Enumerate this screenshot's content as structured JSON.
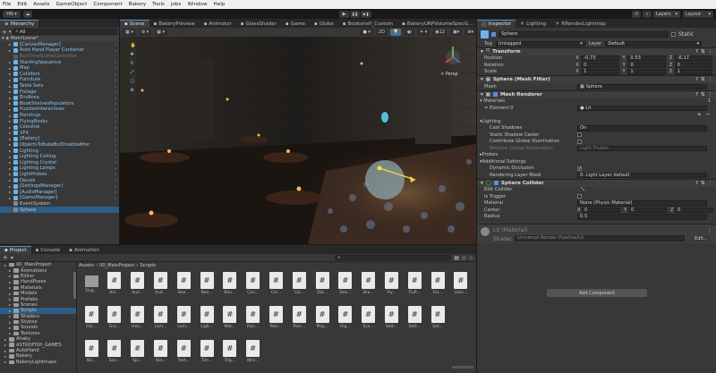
{
  "menu": [
    "File",
    "Edit",
    "Assets",
    "GameObject",
    "Component",
    "Bakery",
    "Tools",
    "Jobs",
    "Window",
    "Help"
  ],
  "toolbar": {
    "account": "HN",
    "cloud": "☁",
    "layers": "Layers",
    "layout": "Layout",
    "play": "▶",
    "pause": "❚❚",
    "step": "▶❚"
  },
  "hierarchy": {
    "tab": "Hierarchy",
    "search_placeholder": "All",
    "scene_name": "MainScene*",
    "items": [
      {
        "label": "[CanvasManager]",
        "blue": true
      },
      {
        "label": "Auto Hand Player Container",
        "blue": true
      },
      {
        "label": "RunTimeSceneController",
        "blue": false,
        "dim": true
      },
      {
        "label": "StartingSequence",
        "blue": true
      },
      {
        "label": "Map",
        "blue": true
      },
      {
        "label": "Colliders",
        "blue": true
      },
      {
        "label": "Furniture",
        "blue": true
      },
      {
        "label": "Table Sets",
        "blue": true
      },
      {
        "label": "Foliage",
        "blue": true
      },
      {
        "label": "EndArea",
        "blue": true
      },
      {
        "label": "BookShelvesPopulators",
        "blue": true
      },
      {
        "label": "PuzzlesInteractives",
        "blue": true
      },
      {
        "label": "Paintings",
        "blue": true
      },
      {
        "label": "FlyingBooks",
        "blue": true
      },
      {
        "label": "Celestial",
        "blue": true
      },
      {
        "label": "VFX",
        "blue": true
      },
      {
        "label": "[Bakery]",
        "blue": true
      },
      {
        "label": "ObjectsToBakeButDisableAfter",
        "blue": true
      },
      {
        "label": "Lighting",
        "blue": true
      },
      {
        "label": "Lighting Ceiling",
        "blue": true
      },
      {
        "label": "Lighting Crystal",
        "blue": true
      },
      {
        "label": "Lighting Lamps",
        "blue": true
      },
      {
        "label": "LightProbes",
        "blue": true
      },
      {
        "label": "Decals",
        "blue": true
      },
      {
        "label": "[SettingsManager]",
        "blue": true
      },
      {
        "label": "[AudioManager]",
        "blue": true
      },
      {
        "label": "[GameManager]",
        "blue": true
      },
      {
        "label": "EventSystem",
        "blue": false
      },
      {
        "label": "Sphere",
        "blue": false,
        "selected": true
      }
    ]
  },
  "scene": {
    "tabs": [
      "Scene",
      "BakeryPreview",
      "Animator",
      "GlassShader",
      "Game",
      "Globe",
      "Bookshelf_Custom",
      "BakeryURPVolumeSpecG..."
    ],
    "mode_2d": "2D",
    "persp": "< Persp",
    "gizmo_count": "12"
  },
  "inspector": {
    "tabs": [
      "Inspector",
      "Lighting",
      "ftRenderLightmap"
    ],
    "object_name": "Sphere",
    "static_label": "Static",
    "tag_label": "Tag",
    "tag_value": "Untagged",
    "layer_label": "Layer",
    "layer_value": "Default",
    "transform": {
      "title": "Transform",
      "position": {
        "label": "Position",
        "x": "-0.73",
        "y": "0.53",
        "z": "-6.17"
      },
      "rotation": {
        "label": "Rotation",
        "x": "0",
        "y": "0",
        "z": "0"
      },
      "scale": {
        "label": "Scale",
        "x": "1",
        "y": "1",
        "z": "1"
      }
    },
    "mesh_filter": {
      "title": "Sphere (Mesh Filter)",
      "mesh_label": "Mesh",
      "mesh_value": "Sphere"
    },
    "mesh_renderer": {
      "title": "Mesh Renderer",
      "materials_label": "Materials",
      "materials_count": "1",
      "element0_label": "Element 0",
      "element0_value": "Lit",
      "lighting_label": "Lighting",
      "cast_shadows_label": "Cast Shadows",
      "cast_shadows_value": "On",
      "static_shadow_caster_label": "Static Shadow Caster",
      "contribute_gi_label": "Contribute Global Illumination",
      "receive_gi_label": "Receive Global Illumination",
      "receive_gi_value": "Light Probes",
      "probes_label": "Probes",
      "additional_label": "Additional Settings",
      "dynamic_occlusion_label": "Dynamic Occlusion",
      "rendering_layer_label": "Rendering Layer Mask",
      "rendering_layer_value": "0: Light Layer default"
    },
    "sphere_collider": {
      "title": "Sphere Collider",
      "edit_label": "Edit Collider",
      "trigger_label": "Is Trigger",
      "material_label": "Material",
      "material_value": "None (Physic Material)",
      "center_label": "Center",
      "cx": "0",
      "cy": "0",
      "cz": "0",
      "radius_label": "Radius",
      "radius_value": "0.5"
    },
    "material": {
      "name": "Lit (Material)",
      "shader_label": "Shader",
      "shader_value": "Universal Render Pipeline/Lit",
      "edit": "Edit..."
    },
    "add_component": "Add Component"
  },
  "project": {
    "tabs": [
      "Project",
      "Console",
      "Animation"
    ],
    "breadcrumb": [
      "Assets",
      "00_MainProject",
      "Scripts"
    ],
    "tree": [
      {
        "label": "00_MainProject",
        "indent": 1
      },
      {
        "label": "Animations",
        "indent": 2
      },
      {
        "label": "Editor",
        "indent": 2
      },
      {
        "label": "HandPoses",
        "indent": 2
      },
      {
        "label": "Materials",
        "indent": 2
      },
      {
        "label": "Models",
        "indent": 2
      },
      {
        "label": "Prefabs",
        "indent": 2
      },
      {
        "label": "Scenes",
        "indent": 2
      },
      {
        "label": "Scripts",
        "indent": 2,
        "selected": true
      },
      {
        "label": "Shaders",
        "indent": 2
      },
      {
        "label": "Skybox",
        "indent": 2
      },
      {
        "label": "Sounds",
        "indent": 2
      },
      {
        "label": "Textures",
        "indent": 2
      },
      {
        "label": "Ahaky",
        "indent": 1
      },
      {
        "label": "ASTROFISH_GAMES",
        "indent": 1
      },
      {
        "label": "AutoHand",
        "indent": 1
      },
      {
        "label": "Bakery",
        "indent": 1
      },
      {
        "label": "BakeryLightmaps",
        "indent": 1
      }
    ],
    "files_row1": [
      "Sing...",
      "Anl...",
      "Aud...",
      "Aud...",
      "Boo...",
      "Boo...",
      "Boo...",
      "Can...",
      "Cer...",
      "Clo...",
      "Dia...",
      "Doo...",
      "Dra...",
      "Fly...",
      "FlyR...",
      "For...",
      "Gam..."
    ],
    "files_row2": [
      "Glo...",
      "Gra...",
      "Hea...",
      "Lam...",
      "Lam...",
      "Ligh...",
      "Mat...",
      "Pain...",
      "Pain...",
      "Pain...",
      "Play...",
      "Rig...",
      "Sce...",
      "Sett...",
      "Sett...",
      "Set..."
    ],
    "files_row3": [
      "Ski...",
      "Sou...",
      "Spi...",
      "Sta...",
      "Text...",
      "Tim...",
      "Trig...",
      "Wris..."
    ]
  }
}
